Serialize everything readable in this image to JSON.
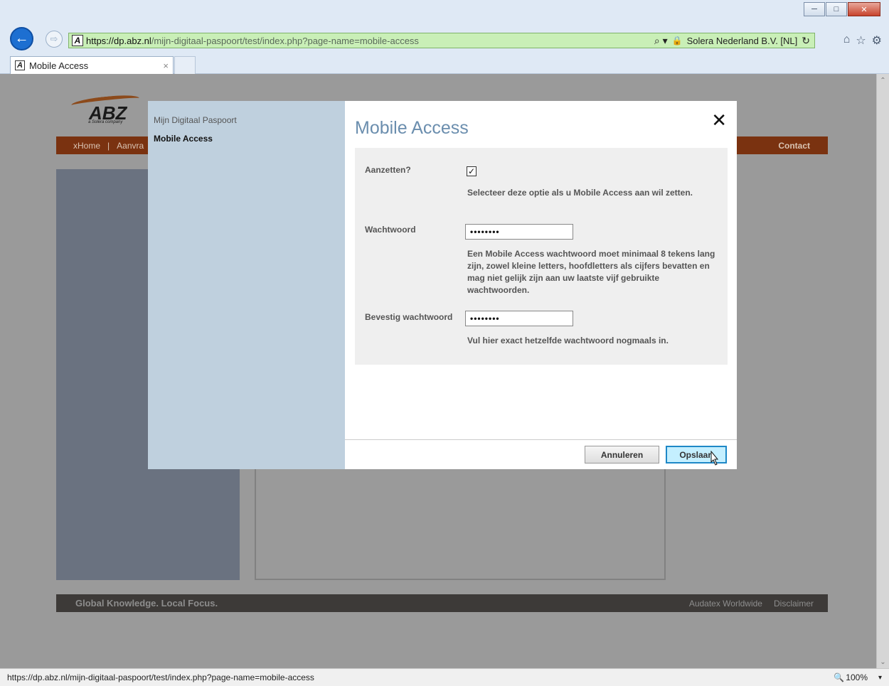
{
  "window": {
    "minimize_label": "─",
    "maximize_label": "□",
    "close_label": "✕"
  },
  "nav": {
    "back_label": "←",
    "forward_label": "⇨"
  },
  "address_bar": {
    "favicon_letter": "A",
    "scheme": "https://",
    "host": "dp.abz.nl",
    "path": "/mijn-digitaal-paspoort/test/index.php?page-name=mobile-access",
    "search_glyph": "⌕ ▾",
    "lock_glyph": "🔒",
    "certificate": "Solera Nederland B.V. [NL]",
    "refresh_glyph": "↻"
  },
  "toolbar_icons": {
    "home": "⌂",
    "favorites": "☆",
    "settings": "⚙"
  },
  "tab": {
    "favicon_letter": "A",
    "title": "Mobile Access",
    "close_label": "×"
  },
  "background_page": {
    "logo_text": "ABZ",
    "logo_sub": "a Solera company",
    "nav_home": "xHome",
    "nav_separator": "|",
    "nav_partial": "Aanvra",
    "nav_contact": "Contact",
    "footer_tagline": "Global Knowledge. Local Focus.",
    "footer_links": [
      "Audatex Worldwide",
      "Disclaimer"
    ]
  },
  "dialog": {
    "sidebar": {
      "breadcrumb": "Mijn Digitaal Paspoort",
      "current": "Mobile Access"
    },
    "title": "Mobile Access",
    "close_label": "✕",
    "fields": {
      "enable_label": "Aanzetten?",
      "enable_checked": true,
      "enable_check_glyph": "✓",
      "enable_help": "Selecteer deze optie als u Mobile Access aan wil zetten.",
      "password_label": "Wachtwoord",
      "password_value": "••••••••",
      "password_help": "Een Mobile Access wachtwoord moet minimaal 8 tekens lang zijn, zowel kleine letters, hoofdletters als cijfers bevatten en mag niet gelijk zijn aan uw laatste vijf gebruikte wachtwoorden.",
      "confirm_label": "Bevestig wachtwoord",
      "confirm_value": "••••••••",
      "confirm_help": "Vul hier exact hetzelfde wachtwoord nogmaals in."
    },
    "buttons": {
      "cancel": "Annuleren",
      "save": "Opslaan"
    }
  },
  "statusbar": {
    "url": "https://dp.abz.nl/mijn-digitaal-paspoort/test/index.php?page-name=mobile-access",
    "zoom": "100%",
    "zoom_glyph": "🔍",
    "zoom_caret": "▾"
  },
  "scrollbar": {
    "up_glyph": "⌃",
    "down_glyph": "⌄"
  },
  "colors": {
    "dialog_title": "#6b8eae",
    "dialog_sidebar": "#bfd0de",
    "save_button_bg": "#c4efff",
    "address_bar_secure": "#c9efb7",
    "bg_navbar": "#7a3210"
  }
}
